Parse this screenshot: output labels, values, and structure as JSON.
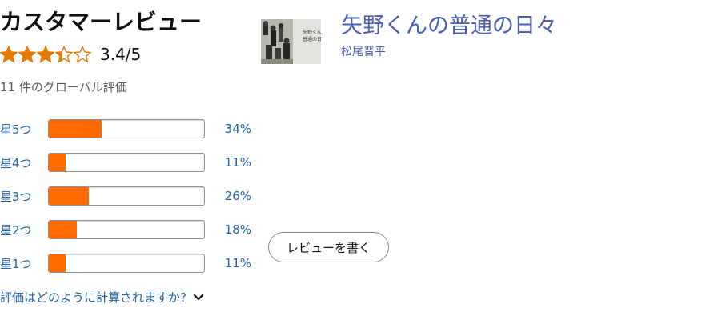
{
  "heading": "カスタマーレビュー",
  "rating": {
    "stars_filled": 3.4,
    "stars_max": 5,
    "text": "3.4/5"
  },
  "total_ratings": "11 件のグローバル評価",
  "histogram": [
    {
      "label": "星5つ",
      "percent_text": "34%",
      "value": 34
    },
    {
      "label": "星4つ",
      "percent_text": "11%",
      "value": 11
    },
    {
      "label": "星3つ",
      "percent_text": "26%",
      "value": 26
    },
    {
      "label": "星2つ",
      "percent_text": "18%",
      "value": 18
    },
    {
      "label": "星1つ",
      "percent_text": "11%",
      "value": 11
    }
  ],
  "how_calculated": "評価はどのように計算されますか?",
  "product": {
    "title": "矢野くんの普通の日々",
    "author": "松尾晋平",
    "cover_text": "矢野くんの普通の日々"
  },
  "write_review_label": "レビューを書く",
  "colors": {
    "bar_fill": "#ff6b00",
    "star": "#e67a00",
    "link": "#2162a1",
    "product_link": "#4a5eb3"
  }
}
